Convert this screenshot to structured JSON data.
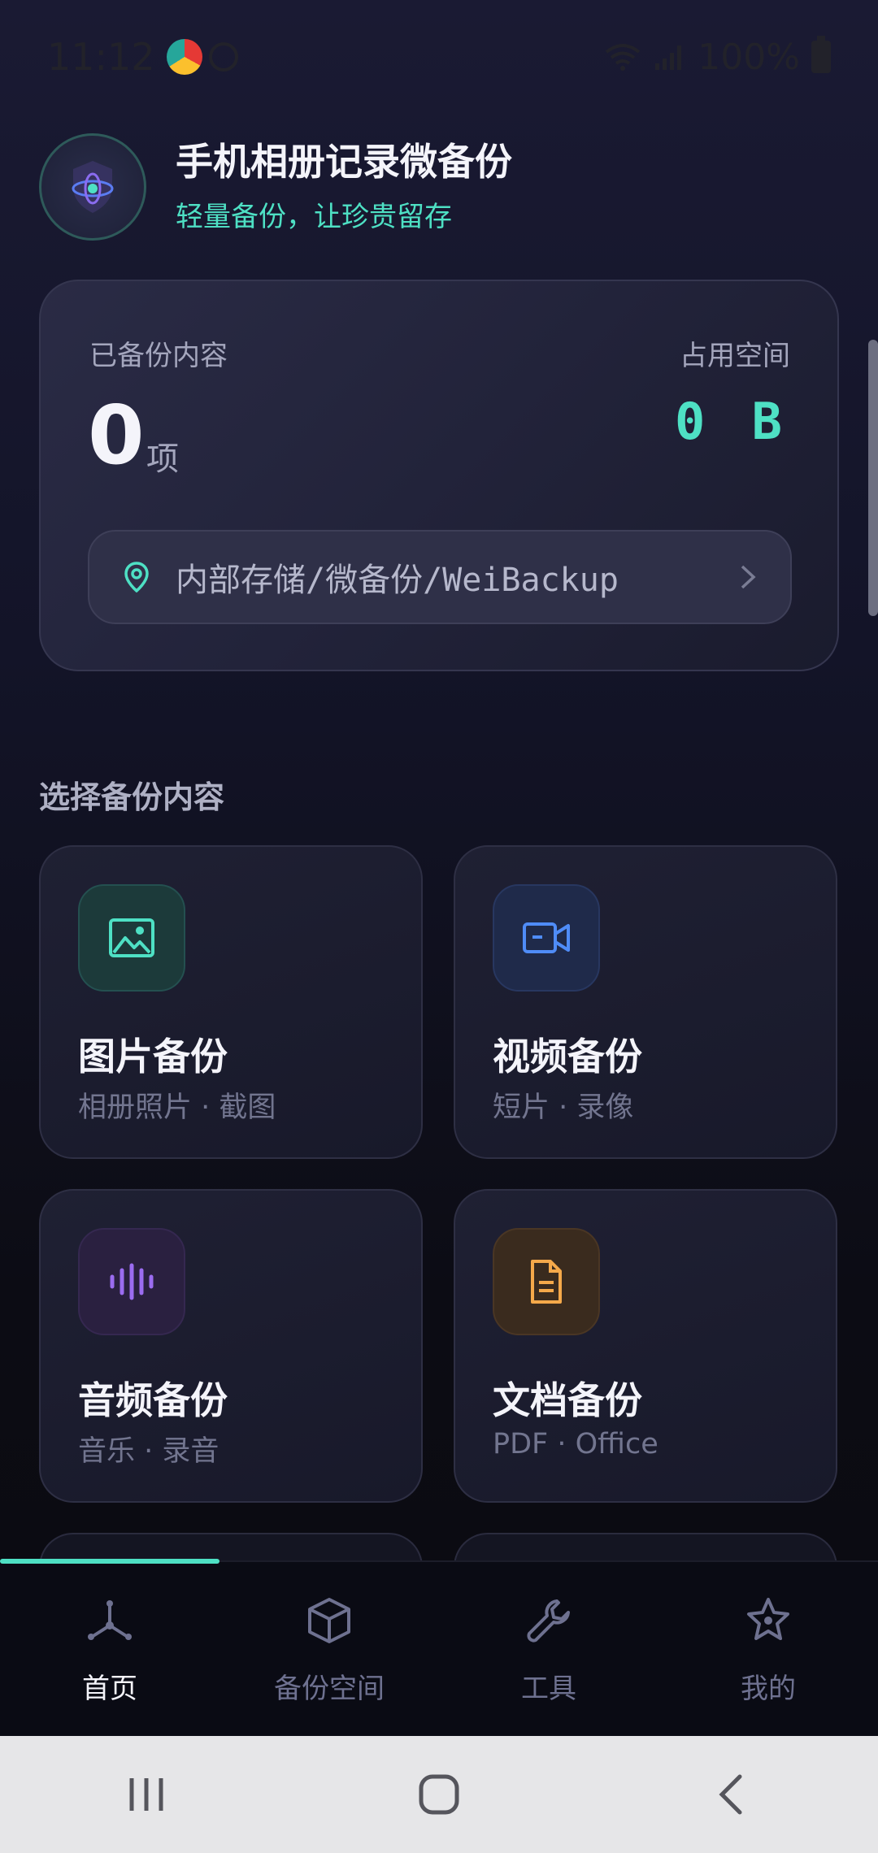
{
  "status_bar": {
    "time": "11:12",
    "battery": "100%",
    "icons": [
      "browser-app-icon",
      "blocked-icon",
      "wifi-icon",
      "signal-icon",
      "battery-icon"
    ]
  },
  "header": {
    "title": "手机相册记录微备份",
    "subtitle": "轻量备份，让珍贵留存",
    "logo_icon": "orbit-shield-icon"
  },
  "summary": {
    "backed_up_label": "已备份内容",
    "count": "0",
    "count_unit": "项",
    "space_label": "占用空间",
    "space_value": "0 B",
    "path": "内部存储/微备份/WeiBackup"
  },
  "section": {
    "title": "选择备份内容"
  },
  "categories": [
    {
      "title": "图片备份",
      "subtitle": "相册照片 · 截图",
      "icon": "image-icon",
      "color": "#4ee0c4"
    },
    {
      "title": "视频备份",
      "subtitle": "短片 · 录像",
      "icon": "video-icon",
      "color": "#4f8cf7"
    },
    {
      "title": "音频备份",
      "subtitle": "音乐 · 录音",
      "icon": "audio-wave-icon",
      "color": "#9b6cf0"
    },
    {
      "title": "文档备份",
      "subtitle": "PDF · Office",
      "icon": "document-icon",
      "color": "#f5a94a"
    }
  ],
  "bottom_nav": {
    "active_index": 0,
    "items": [
      {
        "label": "首页",
        "icon": "hub-icon"
      },
      {
        "label": "备份空间",
        "icon": "box-icon"
      },
      {
        "label": "工具",
        "icon": "wrench-icon"
      },
      {
        "label": "我的",
        "icon": "star-badge-icon"
      }
    ]
  },
  "colors": {
    "accent": "#4ee0c4",
    "background": "#131428"
  }
}
